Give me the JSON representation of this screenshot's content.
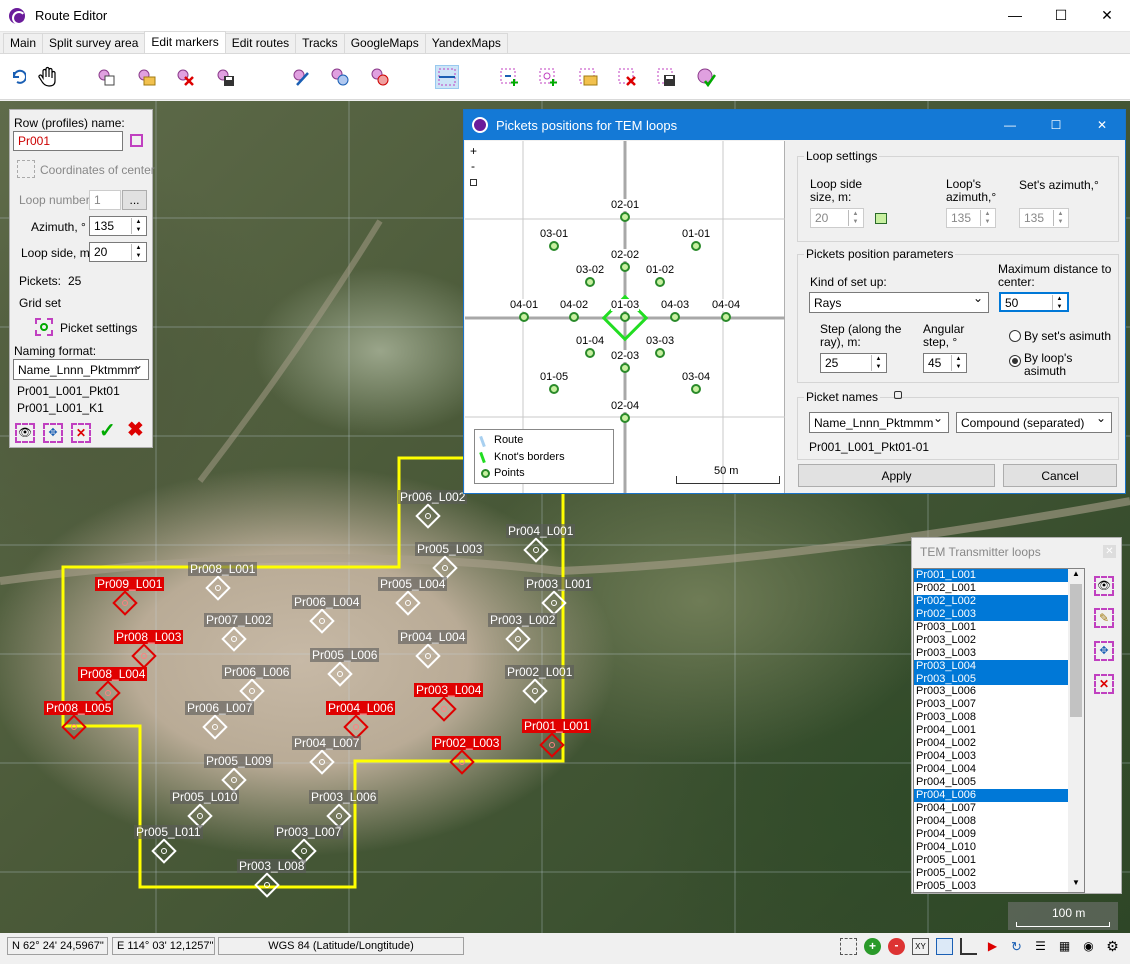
{
  "window": {
    "title": "Route Editor"
  },
  "tabs": [
    "Main",
    "Split survey area",
    "Edit markers",
    "Edit routes",
    "Tracks",
    "GoogleMaps",
    "YandexMaps"
  ],
  "left_panel": {
    "row_label": "Row (profiles) name:",
    "row_value": "Pr001",
    "coords_label": "Coordinates of center",
    "loop_number_label": "Loop number",
    "loop_number_value": "1",
    "ellipsis": "...",
    "azimuth_label": "Azimuth, °",
    "azimuth_value": "135",
    "loop_side_label": "Loop side, m",
    "loop_side_value": "20",
    "pickets_label": "Pickets:",
    "pickets_value": "25",
    "grid_set_label": "Grid set",
    "picket_settings_label": "Picket settings",
    "naming_format_label": "Naming format:",
    "naming_format_value": "Name_Lnnn_Pktmmm",
    "example1": "Pr001_L001_Pkt01",
    "example2": "Pr001_L001_K1"
  },
  "dialog": {
    "title": "Pickets positions for TEM loops",
    "zoom_in": "+",
    "zoom_out": "-",
    "picket_labels": [
      "02-01",
      "03-01",
      "01-01",
      "02-02",
      "03-02",
      "01-02",
      "04-01",
      "04-02",
      "01-03",
      "04-03",
      "04-04",
      "01-04",
      "02-03",
      "03-03",
      "01-05",
      "03-04",
      "02-04"
    ],
    "legend": {
      "route": "Route",
      "knots": "Knot's borders",
      "points": "Points"
    },
    "scale_label": "50 m",
    "loop_settings": {
      "title": "Loop settings",
      "side_label": "Loop side size, m:",
      "side_value": "20",
      "azimuth_label": "Loop's azimuth,°",
      "azimuth_value": "135",
      "set_azimuth_label": "Set's azimuth,°",
      "set_azimuth_value": "135"
    },
    "pickets_params": {
      "title": "Pickets position parameters",
      "kind_label": "Kind of set up:",
      "kind_value": "Rays",
      "max_dist_label": "Maximum distance to center:",
      "max_dist_value": "50",
      "step_label": "Step (along the ray), m:",
      "step_value": "25",
      "angular_label": "Angular step, °",
      "angular_value": "45",
      "by_set": "By set's asimuth",
      "by_loop": "By loop's asimuth"
    },
    "picket_names": {
      "title": "Picket names",
      "format_value": "Name_Lnnn_Pktmmm",
      "style_value": "Compound (separated)",
      "example": "Pr001_L001_Pkt01-01"
    },
    "apply": "Apply",
    "cancel": "Cancel"
  },
  "map_labels": [
    "Pr006_L002",
    "Pr004_L001",
    "Pr005_L003",
    "Pr008_L001",
    "Pr009_L001",
    "Pr005_L004",
    "Pr003_L001",
    "Pr006_L004",
    "Pr007_L002",
    "Pr003_L002",
    "Pr008_L003",
    "Pr004_L004",
    "Pr005_L006",
    "Pr008_L004",
    "Pr006_L006",
    "Pr002_L001",
    "Pr003_L004",
    "Pr008_L005",
    "Pr006_L007",
    "Pr004_L006",
    "Pr001_L001",
    "Pr004_L007",
    "Pr002_L003",
    "Pr005_L009",
    "Pr005_L010",
    "Pr003_L006",
    "Pr005_L011",
    "Pr003_L007",
    "Pr003_L008"
  ],
  "loops_panel": {
    "title": "TEM Transmitter loops",
    "items": [
      "Pr001_L001",
      "Pr002_L001",
      "Pr002_L002",
      "Pr002_L003",
      "Pr003_L001",
      "Pr003_L002",
      "Pr003_L003",
      "Pr003_L004",
      "Pr003_L005",
      "Pr003_L006",
      "Pr003_L007",
      "Pr003_L008",
      "Pr004_L001",
      "Pr004_L002",
      "Pr004_L003",
      "Pr004_L004",
      "Pr004_L005",
      "Pr004_L006",
      "Pr004_L007",
      "Pr004_L008",
      "Pr004_L009",
      "Pr004_L010",
      "Pr005_L001",
      "Pr005_L002",
      "Pr005_L003"
    ],
    "selected": [
      0,
      2,
      3,
      7,
      8,
      17
    ]
  },
  "map_scale": "100 m",
  "status": {
    "lat": "N 62° 24' 24,5967\"",
    "lon": "E 114° 03' 12,1257\"",
    "crs": "WGS 84 (Latitude/Longtitude)"
  },
  "colors": {
    "accent": "#1479d6",
    "selection": "#0078d7",
    "boundary": "#ffff00",
    "loop_red": "#e00000"
  }
}
